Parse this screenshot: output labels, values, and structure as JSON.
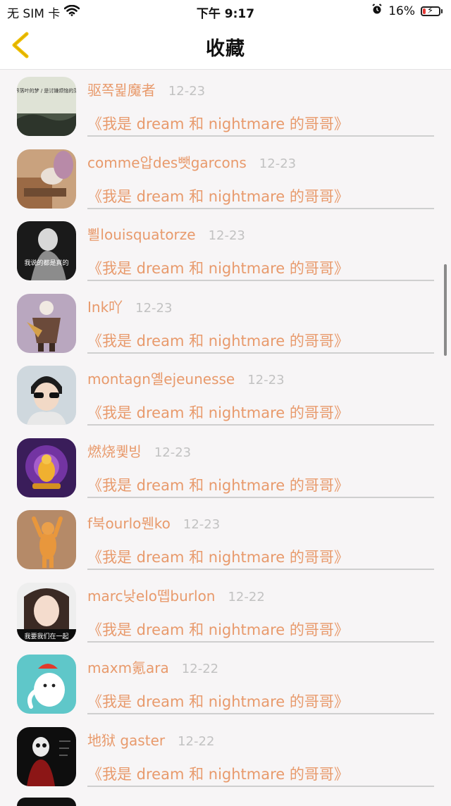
{
  "status_bar": {
    "carrier": "无 SIM 卡",
    "time": "下午 9:17",
    "battery_percent": "16%",
    "battery_level": 0.16,
    "battery_color": "#e53935"
  },
  "nav": {
    "title": "收藏",
    "back_icon": "chevron-left-icon",
    "back_color": "#f0c000"
  },
  "list": {
    "items": [
      {
        "name": "驱쪽뮕魔者",
        "date": "12-23",
        "quote": "《我是 dream 和 nightmare 的哥哥》"
      },
      {
        "name": "comme압des뺏garcons",
        "date": "12-23",
        "quote": "《我是 dream 和 nightmare 的哥哥》"
      },
      {
        "name": "뾜louisquatorze",
        "date": "12-23",
        "quote": "《我是 dream 和 nightmare 的哥哥》"
      },
      {
        "name": "Ink吖",
        "date": "12-23",
        "quote": "《我是 dream 和 nightmare 的哥哥》"
      },
      {
        "name": "montagn옐ejeunesse",
        "date": "12-23",
        "quote": "《我是 dream 和 nightmare 的哥哥》"
      },
      {
        "name": "燃烧퀯빙",
        "date": "12-23",
        "quote": "《我是 dream 和 nightmare 的哥哥》"
      },
      {
        "name": "f북ourlo뭰ko",
        "date": "12-23",
        "quote": "《我是 dream 和 nightmare 的哥哥》"
      },
      {
        "name": "marc낮elo뗍burlon",
        "date": "12-22",
        "quote": "《我是 dream 和 nightmare 的哥哥》"
      },
      {
        "name": "maxm氪ara",
        "date": "12-22",
        "quote": "《我是 dream 和 nightmare 的哥哥》"
      },
      {
        "name": "地狱 gaster",
        "date": "12-22",
        "quote": "《我是 dream 和 nightmare 的哥哥》"
      }
    ]
  },
  "avatar_texts": {
    "avatar_1": "世界落叶的梦 / 是讨嫌烦恼的落叶",
    "avatar_3": "我说的都是真的",
    "avatar_8": "我要我们在一起"
  },
  "colors": {
    "name": "#e89a6c",
    "date": "#c2c2c2",
    "quote": "#e89a6c",
    "divider": "#cfcfcf",
    "background": "#f7f5f6"
  }
}
